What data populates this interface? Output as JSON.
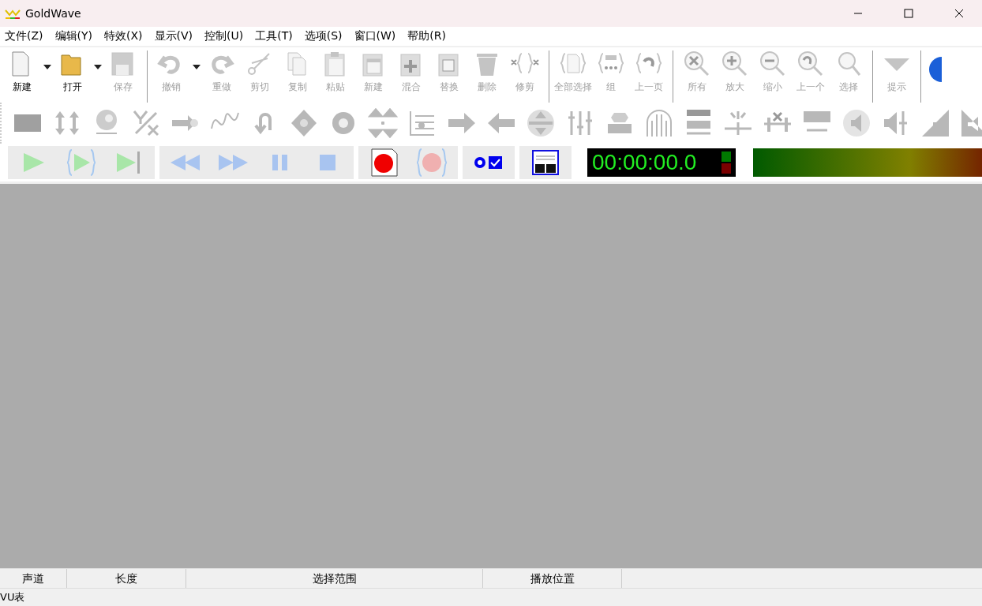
{
  "window": {
    "title": "GoldWave"
  },
  "menu": [
    "文件(Z)",
    "编辑(Y)",
    "特效(X)",
    "显示(V)",
    "控制(U)",
    "工具(T)",
    "选项(S)",
    "窗口(W)",
    "帮助(R)"
  ],
  "toolbar_groups": [
    [
      {
        "label": "新建",
        "disabled": false,
        "dropdown": true
      },
      {
        "label": "打开",
        "disabled": false,
        "dropdown": true
      },
      {
        "label": "保存",
        "disabled": true,
        "dropdown": false
      }
    ],
    [
      {
        "label": "撤销",
        "disabled": true,
        "dropdown": true
      },
      {
        "label": "重做",
        "disabled": true,
        "dropdown": false
      },
      {
        "label": "剪切",
        "disabled": true,
        "dropdown": false
      },
      {
        "label": "复制",
        "disabled": true,
        "dropdown": false
      },
      {
        "label": "粘贴",
        "disabled": true,
        "dropdown": false
      },
      {
        "label": "新建",
        "disabled": true,
        "dropdown": false
      },
      {
        "label": "混合",
        "disabled": true,
        "dropdown": false
      },
      {
        "label": "替换",
        "disabled": true,
        "dropdown": false
      },
      {
        "label": "删除",
        "disabled": true,
        "dropdown": false
      },
      {
        "label": "修剪",
        "disabled": true,
        "dropdown": false
      }
    ],
    [
      {
        "label": "全部选择",
        "disabled": true,
        "dropdown": false
      },
      {
        "label": "组",
        "disabled": true,
        "dropdown": false
      },
      {
        "label": "上一页",
        "disabled": true,
        "dropdown": false
      }
    ],
    [
      {
        "label": "所有",
        "disabled": true,
        "dropdown": false
      },
      {
        "label": "放大",
        "disabled": true,
        "dropdown": false
      },
      {
        "label": "缩小",
        "disabled": true,
        "dropdown": false
      },
      {
        "label": "上一个",
        "disabled": true,
        "dropdown": false
      },
      {
        "label": "选择",
        "disabled": true,
        "dropdown": false
      }
    ],
    [
      {
        "label": "提示",
        "disabled": true,
        "dropdown": false
      }
    ]
  ],
  "time_display": "00:00:00.0",
  "status_columns": [
    "声道",
    "长度",
    "选择范围",
    "播放位置"
  ],
  "status_text": "VU表"
}
